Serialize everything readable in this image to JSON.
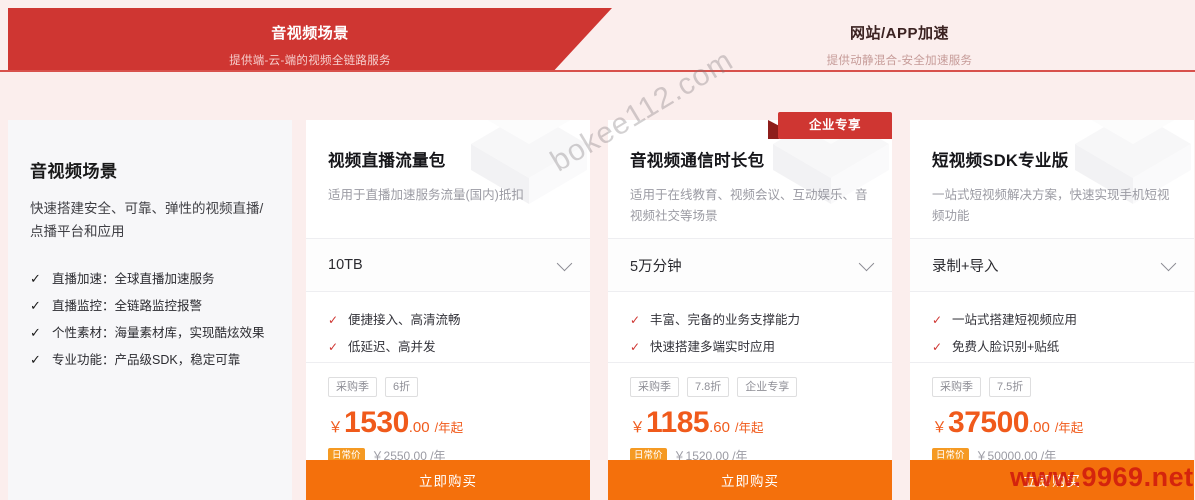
{
  "tabs": [
    {
      "title": "音视频场景",
      "subtitle": "提供端-云-端的视频全链路服务",
      "active": true
    },
    {
      "title": "网站/APP加速",
      "subtitle": "提供动静混合-安全加速服务",
      "active": false
    }
  ],
  "info_panel": {
    "title": "音视频场景",
    "description": "快速搭建安全、可靠、弹性的视频直播/点播平台和应用",
    "features": [
      "直播加速：全球直播加速服务",
      "直播监控：全链路监控报警",
      "个性素材：海量素材库，实现酷炫效果",
      "专业功能：产品级SDK，稳定可靠"
    ],
    "tick_icon": "check-icon"
  },
  "cards": [
    {
      "title": "视频直播流量包",
      "description": "适用于直播加速服务流量(国内)抵扣",
      "badge": null,
      "select_value": "10TB",
      "select_icon": "chevron-down-icon",
      "features": [
        "便捷接入、高清流畅",
        "低延迟、高并发"
      ],
      "tags": [
        "采购季",
        "6折"
      ],
      "currency": "￥",
      "price_int": "1530",
      "price_dec": ".00",
      "price_unit": "/年起",
      "orig_badge": "日常价",
      "orig_price": "￥2550.00 /年",
      "buy_label": "立即购买"
    },
    {
      "title": "音视频通信时长包",
      "description": "适用于在线教育、视频会议、互动娱乐、音视频社交等场景",
      "badge": "企业专享",
      "select_value": "5万分钟",
      "select_icon": "chevron-down-icon",
      "features": [
        "丰富、完备的业务支撑能力",
        "快速搭建多端实时应用"
      ],
      "tags": [
        "采购季",
        "7.8折",
        "企业专享"
      ],
      "currency": "￥",
      "price_int": "1185",
      "price_dec": ".60",
      "price_unit": "/年起",
      "orig_badge": "日常价",
      "orig_price": "￥1520.00 /年",
      "buy_label": "立即购买"
    },
    {
      "title": "短视频SDK专业版",
      "description": "一站式短视频解决方案，快速实现手机短视频功能",
      "badge": null,
      "select_value": "录制+导入",
      "select_icon": "chevron-down-icon",
      "features": [
        "一站式搭建短视频应用",
        "免费人脸识别+贴纸"
      ],
      "tags": [
        "采购季",
        "7.5折"
      ],
      "currency": "￥",
      "price_int": "37500",
      "price_dec": ".00",
      "price_unit": "/年起",
      "orig_badge": "日常价",
      "orig_price": "￥50000.00 /年",
      "buy_label": "立即购买"
    }
  ],
  "watermarks": {
    "center": "bokee112.com",
    "corner": "www.9969.net"
  },
  "colors": {
    "brand_red": "#cf3632",
    "accent_orange": "#f4700c",
    "price_orange": "#f05a1b",
    "page_bg": "#fbeeed"
  },
  "glyphs": {
    "check": "✓",
    "yen": "￥"
  }
}
